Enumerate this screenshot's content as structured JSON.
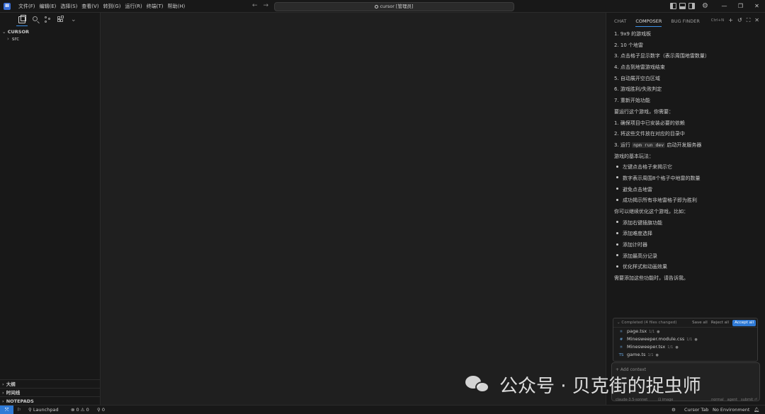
{
  "menu": [
    "文件(F)",
    "编辑(E)",
    "选择(S)",
    "查看(V)",
    "转到(G)",
    "运行(R)",
    "终端(T)",
    "帮助(H)"
  ],
  "command_center": "cursor [管理员]",
  "sidebar": {
    "root": "CURSOR",
    "tree": [
      {
        "label": "src"
      }
    ],
    "sections": [
      "大纲",
      "时间线",
      "NOTEPADS"
    ]
  },
  "panel": {
    "tabs": [
      "CHAT",
      "COMPOSER",
      "BUG FINDER"
    ],
    "active_tab": "COMPOSER",
    "shortcut": "Ctrl+N",
    "lines": [
      {
        "type": "text",
        "text": "1. 9x9 的游戏板"
      },
      {
        "type": "text",
        "text": "2. 10 个地雷"
      },
      {
        "type": "text",
        "text": "3. 点击格子显示数字（表示周围地雷数量）"
      },
      {
        "type": "text",
        "text": "4. 点击到地雷游戏结束"
      },
      {
        "type": "text",
        "text": "5. 自动展开空白区域"
      },
      {
        "type": "text",
        "text": "6. 游戏胜利/失败判定"
      },
      {
        "type": "text",
        "text": "7. 重新开始功能"
      },
      {
        "type": "text",
        "text": "要运行这个游戏，你需要："
      },
      {
        "type": "text",
        "text": "1. 确保项目中已安装必要的依赖"
      },
      {
        "type": "text",
        "text": "2. 将这些文件放在对应的目录中"
      },
      {
        "type": "code",
        "pre": "3. 运行 ",
        "code": "npm run dev",
        "post": " 启动开发服务器"
      },
      {
        "type": "text",
        "text": "游戏的基本玩法："
      },
      {
        "type": "bullet",
        "text": "左键点击格子来揭示它"
      },
      {
        "type": "bullet",
        "text": "数字表示周围8个格子中地雷的数量"
      },
      {
        "type": "bullet",
        "text": "避免点击地雷"
      },
      {
        "type": "bullet",
        "text": "成功揭示所有非地雷格子即为胜利"
      },
      {
        "type": "text",
        "text": "你可以继续优化这个游戏，比如："
      },
      {
        "type": "bullet",
        "text": "添加右键插旗功能"
      },
      {
        "type": "bullet",
        "text": "添加难度选择"
      },
      {
        "type": "bullet",
        "text": "添加计时器"
      },
      {
        "type": "bullet",
        "text": "添加最高分记录"
      },
      {
        "type": "bullet",
        "text": "优化样式和动画效果"
      },
      {
        "type": "text",
        "text": "需要添加这些功能时，请告诉我。"
      }
    ],
    "changes": {
      "header": "Completed (4 files changed)",
      "save_all": "Save all",
      "reject_all": "Reject all",
      "accept_all": "Accept all",
      "files": [
        {
          "icon": "⚛",
          "name": "page.tsx",
          "ver": "1/1"
        },
        {
          "icon": "#",
          "name": "Minesweeper.module.css",
          "ver": "1/1"
        },
        {
          "icon": "⚛",
          "name": "Minesweeper.tsx",
          "ver": "1/1"
        },
        {
          "icon": "TS",
          "name": "game.ts",
          "ver": "1/1"
        }
      ]
    },
    "input": {
      "add_context": "+ Add context",
      "model": "claude-3.5-sonnet",
      "image": "⊡ image",
      "mode_normal": "normal",
      "mode_agent": "agent",
      "submit": "submit ⏎"
    }
  },
  "watermark": "公众号 · 贝克街的捉虫师",
  "status": {
    "launchpad": "Launchpad",
    "problems": "⊗ 0 ⚠ 0",
    "ports": "⚲ 0",
    "cursor_tab": "Cursor Tab",
    "environment": "No Environment"
  }
}
